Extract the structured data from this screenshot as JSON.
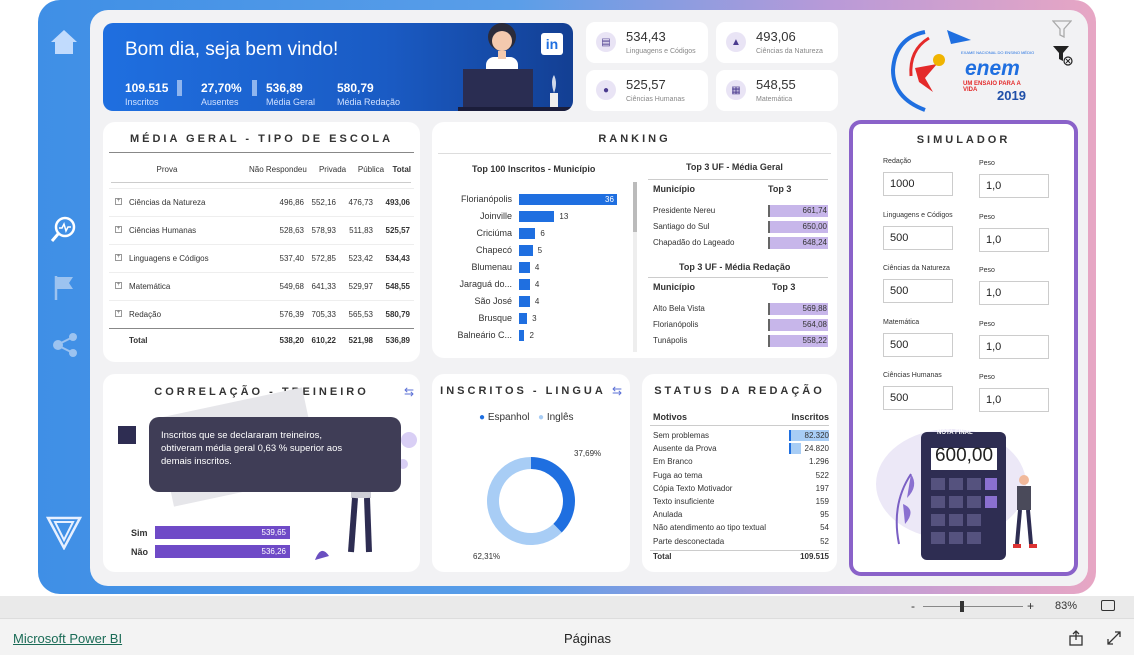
{
  "sidebar": {
    "icons": [
      "home-icon",
      "analytics-icon",
      "flag-icon",
      "share-icon",
      "logo-icon"
    ]
  },
  "welcome": {
    "greeting": "Bom dia, seja bem vindo!",
    "stats": [
      {
        "value": "109.515",
        "label": "Inscritos"
      },
      {
        "value": "27,70%",
        "label": "Ausentes"
      },
      {
        "value": "536,89",
        "label": "Média Geral"
      },
      {
        "value": "580,79",
        "label": "Média Redação"
      }
    ],
    "linkedin": "in"
  },
  "kpis": [
    {
      "value": "534,43",
      "label": "Linguagens e Códigos",
      "icon": "book-icon"
    },
    {
      "value": "493,06",
      "label": "Ciências da Natureza",
      "icon": "flask-icon"
    },
    {
      "value": "525,57",
      "label": "Ciências Humanas",
      "icon": "head-icon"
    },
    {
      "value": "548,55",
      "label": "Matemática",
      "icon": "calculator-icon"
    }
  ],
  "logo": {
    "title": "enem",
    "subtitle": "UM ENSAIO PARA A VIDA",
    "year": "2019",
    "top_text": "EXAME NACIONAL DO ENSINO MÉDIO"
  },
  "media_geral": {
    "title": "MÉDIA GERAL - TIPO DE ESCOLA",
    "headers": [
      "Prova",
      "Não Respondeu",
      "Privada",
      "Pública",
      "Total"
    ],
    "rows": [
      [
        "Ciências da Natureza",
        "496,86",
        "552,16",
        "476,73",
        "493,06"
      ],
      [
        "Ciências Humanas",
        "528,63",
        "578,93",
        "511,83",
        "525,57"
      ],
      [
        "Linguagens e Códigos",
        "537,40",
        "572,85",
        "523,42",
        "534,43"
      ],
      [
        "Matemática",
        "549,68",
        "641,33",
        "529,97",
        "548,55"
      ],
      [
        "Redação",
        "576,39",
        "705,33",
        "565,53",
        "580,79"
      ]
    ],
    "total": [
      "Total",
      "538,20",
      "610,22",
      "521,98",
      "536,89"
    ]
  },
  "ranking": {
    "title": "RANKING",
    "municipio_title": "Top 100 Inscritos - Município",
    "municipios": [
      {
        "name": "Florianópolis",
        "value": 36
      },
      {
        "name": "Joinville",
        "value": 13
      },
      {
        "name": "Criciúma",
        "value": 6
      },
      {
        "name": "Chapecó",
        "value": 5
      },
      {
        "name": "Blumenau",
        "value": 4
      },
      {
        "name": "Jaraguá do...",
        "value": 4
      },
      {
        "name": "São José",
        "value": 4
      },
      {
        "name": "Brusque",
        "value": 3
      },
      {
        "name": "Balneário C...",
        "value": 2
      }
    ],
    "uf_geral_title": "Top 3 UF - Média Geral",
    "uf_geral_headers": [
      "Município",
      "Top 3"
    ],
    "uf_geral": [
      {
        "name": "Presidente Nereu",
        "value": "661,74"
      },
      {
        "name": "Santiago do Sul",
        "value": "650,00"
      },
      {
        "name": "Chapadão do Lageado",
        "value": "648,24"
      }
    ],
    "uf_redacao_title": "Top 3 UF - Média Redação",
    "uf_redacao_headers": [
      "Município",
      "Top 3"
    ],
    "uf_redacao": [
      {
        "name": "Alto Bela Vista",
        "value": "569,88"
      },
      {
        "name": "Florianópolis",
        "value": "564,08"
      },
      {
        "name": "Tunápolis",
        "value": "558,22"
      }
    ]
  },
  "simulador": {
    "title": "SIMULADOR",
    "peso_label": "Peso",
    "fields": [
      {
        "label": "Redação",
        "value": "1000",
        "peso": "1,0"
      },
      {
        "label": "Linguagens e Códigos",
        "value": "500",
        "peso": "1,0"
      },
      {
        "label": "Ciências da Natureza",
        "value": "500",
        "peso": "1,0"
      },
      {
        "label": "Matemática",
        "value": "500",
        "peso": "1,0"
      },
      {
        "label": "Ciências Humanas",
        "value": "500",
        "peso": "1,0"
      }
    ],
    "nota_label": "NOTA FINAL",
    "nota_value": "600,00"
  },
  "correlacao": {
    "title": "CORRELAÇÃO - TREINEIRO",
    "text": "Inscritos que se declararam treineiros, obtiveram média geral 0,63 % superior aos demais inscritos.",
    "bars": [
      {
        "label": "Sim",
        "value": "539,65"
      },
      {
        "label": "Não",
        "value": "536,26"
      }
    ]
  },
  "lingua": {
    "title": "INSCRITOS - LINGUA",
    "legend": [
      "Espanhol",
      "Inglês"
    ],
    "colors": [
      "#1f6fe0",
      "#a8cdf5"
    ],
    "chart_data": {
      "type": "pie",
      "categories": [
        "Espanhol",
        "Inglês"
      ],
      "values": [
        37.69,
        62.31
      ],
      "labels": [
        "37,69%",
        "62,31%"
      ]
    }
  },
  "status": {
    "title": "STATUS DA REDAÇÃO",
    "headers": [
      "Motivos",
      "Inscritos"
    ],
    "rows": [
      {
        "motivo": "Sem problemas",
        "value": "82.320",
        "num": 82320
      },
      {
        "motivo": "Ausente da Prova",
        "value": "24.820",
        "num": 24820
      },
      {
        "motivo": "Em Branco",
        "value": "1.296",
        "num": 1296
      },
      {
        "motivo": "Fuga ao tema",
        "value": "522",
        "num": 522
      },
      {
        "motivo": "Cópia Texto Motivador",
        "value": "197",
        "num": 197
      },
      {
        "motivo": "Texto insuficiente",
        "value": "159",
        "num": 159
      },
      {
        "motivo": "Anulada",
        "value": "95",
        "num": 95
      },
      {
        "motivo": "Não atendimento ao tipo textual",
        "value": "54",
        "num": 54
      },
      {
        "motivo": "Parte desconectada",
        "value": "52",
        "num": 52
      }
    ],
    "total_label": "Total",
    "total_value": "109.515"
  },
  "zoom": {
    "minus": "-",
    "plus": "+",
    "level": "83%"
  },
  "footer": {
    "brand": "Microsoft Power BI",
    "pages": "Páginas"
  }
}
